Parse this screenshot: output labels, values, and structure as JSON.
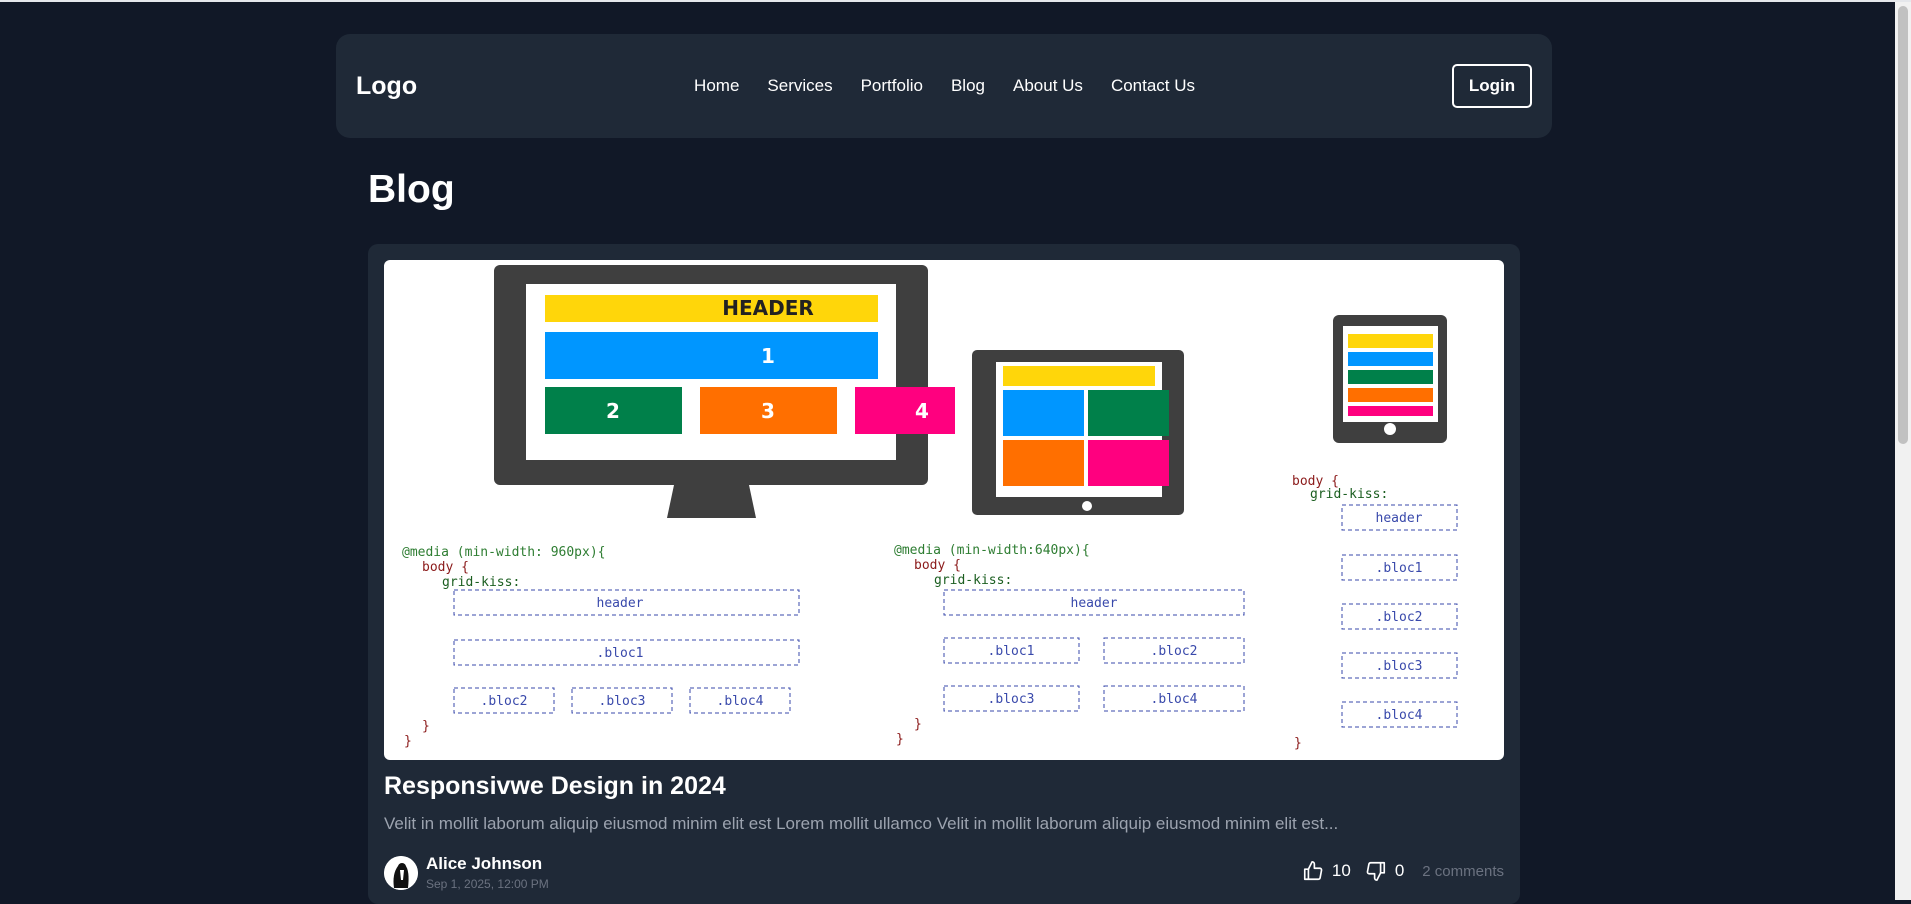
{
  "header": {
    "logo": "Logo",
    "nav": [
      "Home",
      "Services",
      "Portfolio",
      "Blog",
      "About Us",
      "Contact Us"
    ],
    "login_label": "Login"
  },
  "page": {
    "title": "Blog"
  },
  "post": {
    "title": "Responsivwe Design in 2024",
    "excerpt": "Velit in mollit laborum aliquip eiusmod minim elit est Lorem mollit ullamco Velit in mollit laborum aliquip eiusmod minim elit est...",
    "author": "Alice Johnson",
    "date": "Sep 1, 2025, 12:00 PM",
    "likes": "10",
    "dislikes": "0",
    "comments": "2 comments",
    "image": {
      "desktop_header": "HEADER",
      "desktop_blocks": [
        "1",
        "2",
        "3",
        "4"
      ],
      "code_desktop": "@media (min-width: 960px){",
      "code_tablet": "@media (min-width:640px){",
      "code_body": "body {",
      "code_grid": "grid-kiss:",
      "code_header": "header",
      "code_blocks": [
        ".bloc1",
        ".bloc2",
        ".bloc3",
        ".bloc4"
      ],
      "code_close": "}"
    }
  },
  "colors": {
    "background": "#111827",
    "card": "#1f2937",
    "yellow": "#ffd60a",
    "blue": "#0096ff",
    "green": "#00804a",
    "orange": "#ff6f00",
    "pink": "#ff007f",
    "device": "#3f3f3f"
  }
}
